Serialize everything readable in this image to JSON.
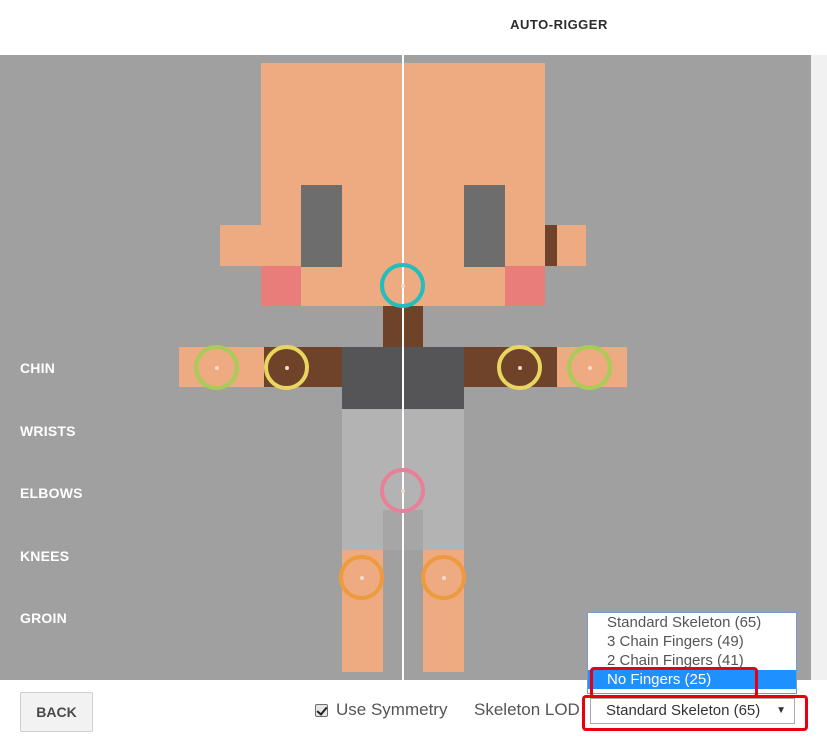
{
  "header": {
    "title": "AUTO-RIGGER"
  },
  "joint_labels": [
    "CHIN",
    "WRISTS",
    "ELBOWS",
    "KNEES",
    "GROIN"
  ],
  "colors": {
    "viewport_bg": "#a0a0a0",
    "skin": "#eeaa80",
    "eyes": "#6d6d6d",
    "cheeks": "#e87d7a",
    "brown": "#6f4329",
    "shirt": "#555557",
    "pants": "#b3b3b3",
    "chin_handle": "#22bdbd",
    "wrist_handle": "#a8cc55",
    "elbow_handle": "#e8d660",
    "groin_handle": "#e8809a",
    "knee_handle": "#ee9a3e",
    "dropdown_selected": "#1e90ff",
    "highlight": "#e8000b"
  },
  "footer": {
    "back_label": "BACK",
    "symmetry_label": "Use Symmetry",
    "symmetry_checked": true,
    "lod_label": "Skeleton LOD",
    "lod_value": "Standard Skeleton (65)",
    "lod_options": [
      "Standard Skeleton (65)",
      "3 Chain Fingers (49)",
      "2 Chain Fingers (41)",
      "No Fingers (25)"
    ],
    "lod_highlighted_option": "No Fingers (25)"
  }
}
